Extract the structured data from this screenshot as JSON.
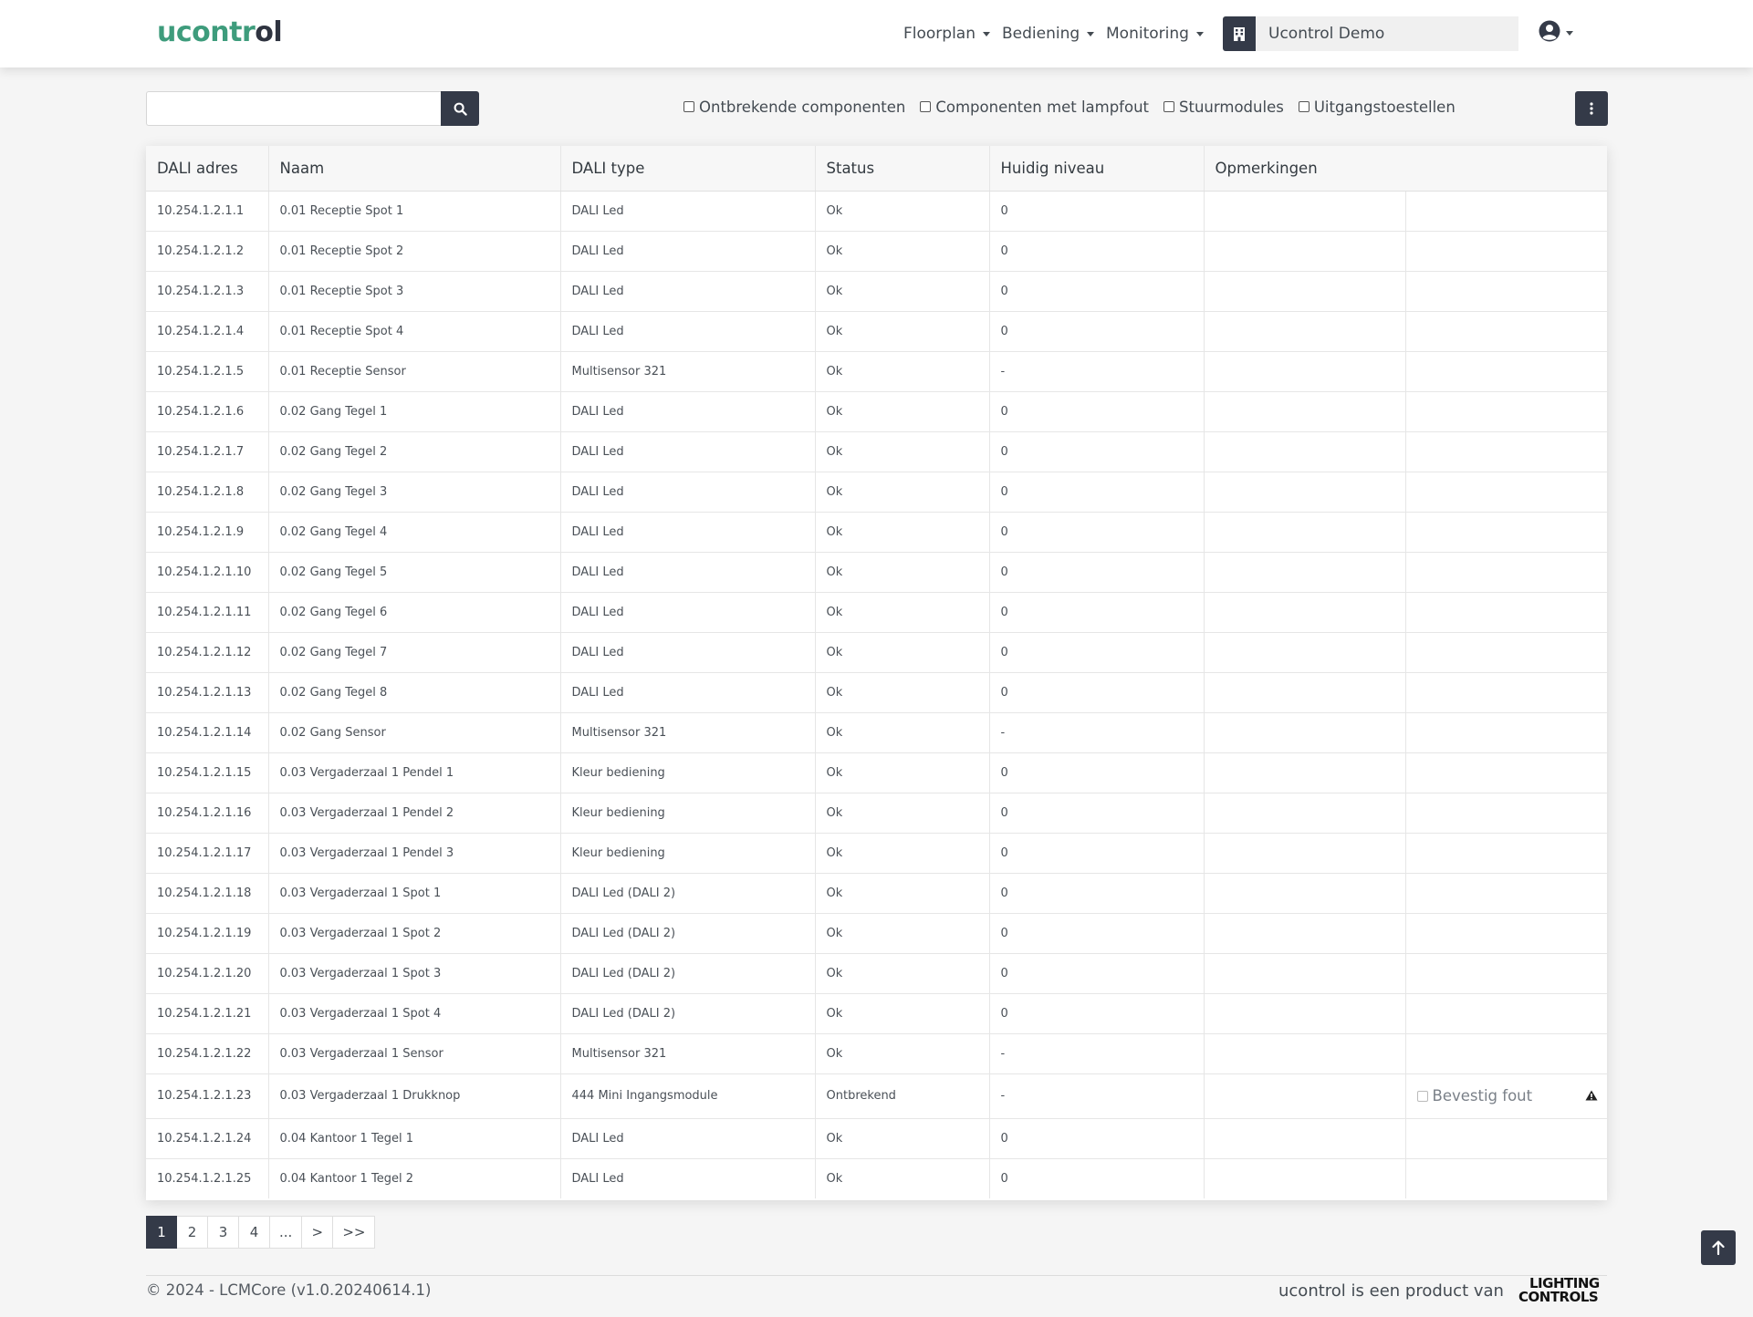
{
  "navbar": {
    "logo_part1": "ucontr",
    "logo_part2": "l",
    "menu": [
      {
        "label": "Floorplan"
      },
      {
        "label": "Bediening"
      },
      {
        "label": "Monitoring"
      }
    ],
    "site_name": "Ucontrol Demo",
    "icons": {
      "site": "building-icon",
      "user": "user-circle-icon"
    }
  },
  "toolbar": {
    "search_value": "",
    "filters": [
      {
        "label": "Ontbrekende componenten",
        "checked": false
      },
      {
        "label": "Componenten met lampfout",
        "checked": false
      },
      {
        "label": "Stuurmodules",
        "checked": false
      },
      {
        "label": "Uitgangstoestellen",
        "checked": false
      }
    ]
  },
  "table": {
    "headers": [
      "DALI adres",
      "Naam",
      "DALI type",
      "Status",
      "Huidig niveau",
      "Opmerkingen"
    ],
    "rows": [
      {
        "adres": "10.254.1.2.1.1",
        "naam": "0.01 Receptie Spot 1",
        "type": "DALI Led",
        "status": "Ok",
        "niveau": "0"
      },
      {
        "adres": "10.254.1.2.1.2",
        "naam": "0.01 Receptie Spot 2",
        "type": "DALI Led",
        "status": "Ok",
        "niveau": "0"
      },
      {
        "adres": "10.254.1.2.1.3",
        "naam": "0.01 Receptie Spot 3",
        "type": "DALI Led",
        "status": "Ok",
        "niveau": "0"
      },
      {
        "adres": "10.254.1.2.1.4",
        "naam": "0.01 Receptie Spot 4",
        "type": "DALI Led",
        "status": "Ok",
        "niveau": "0"
      },
      {
        "adres": "10.254.1.2.1.5",
        "naam": "0.01 Receptie Sensor",
        "type": "Multisensor 321",
        "status": "Ok",
        "niveau": "-"
      },
      {
        "adres": "10.254.1.2.1.6",
        "naam": "0.02 Gang Tegel 1",
        "type": "DALI Led",
        "status": "Ok",
        "niveau": "0"
      },
      {
        "adres": "10.254.1.2.1.7",
        "naam": "0.02 Gang Tegel 2",
        "type": "DALI Led",
        "status": "Ok",
        "niveau": "0"
      },
      {
        "adres": "10.254.1.2.1.8",
        "naam": "0.02 Gang Tegel 3",
        "type": "DALI Led",
        "status": "Ok",
        "niveau": "0"
      },
      {
        "adres": "10.254.1.2.1.9",
        "naam": "0.02 Gang Tegel 4",
        "type": "DALI Led",
        "status": "Ok",
        "niveau": "0"
      },
      {
        "adres": "10.254.1.2.1.10",
        "naam": "0.02 Gang Tegel 5",
        "type": "DALI Led",
        "status": "Ok",
        "niveau": "0"
      },
      {
        "adres": "10.254.1.2.1.11",
        "naam": "0.02 Gang Tegel 6",
        "type": "DALI Led",
        "status": "Ok",
        "niveau": "0"
      },
      {
        "adres": "10.254.1.2.1.12",
        "naam": "0.02 Gang Tegel 7",
        "type": "DALI Led",
        "status": "Ok",
        "niveau": "0"
      },
      {
        "adres": "10.254.1.2.1.13",
        "naam": "0.02 Gang Tegel 8",
        "type": "DALI Led",
        "status": "Ok",
        "niveau": "0"
      },
      {
        "adres": "10.254.1.2.1.14",
        "naam": "0.02 Gang Sensor",
        "type": "Multisensor 321",
        "status": "Ok",
        "niveau": "-"
      },
      {
        "adres": "10.254.1.2.1.15",
        "naam": "0.03 Vergaderzaal 1 Pendel 1",
        "type": "Kleur bediening",
        "status": "Ok",
        "niveau": "0"
      },
      {
        "adres": "10.254.1.2.1.16",
        "naam": "0.03 Vergaderzaal 1 Pendel 2",
        "type": "Kleur bediening",
        "status": "Ok",
        "niveau": "0"
      },
      {
        "adres": "10.254.1.2.1.17",
        "naam": "0.03 Vergaderzaal 1 Pendel 3",
        "type": "Kleur bediening",
        "status": "Ok",
        "niveau": "0"
      },
      {
        "adres": "10.254.1.2.1.18",
        "naam": "0.03 Vergaderzaal 1 Spot 1",
        "type": "DALI Led (DALI 2)",
        "status": "Ok",
        "niveau": "0"
      },
      {
        "adres": "10.254.1.2.1.19",
        "naam": "0.03 Vergaderzaal 1 Spot 2",
        "type": "DALI Led (DALI 2)",
        "status": "Ok",
        "niveau": "0"
      },
      {
        "adres": "10.254.1.2.1.20",
        "naam": "0.03 Vergaderzaal 1 Spot 3",
        "type": "DALI Led (DALI 2)",
        "status": "Ok",
        "niveau": "0"
      },
      {
        "adres": "10.254.1.2.1.21",
        "naam": "0.03 Vergaderzaal 1 Spot 4",
        "type": "DALI Led (DALI 2)",
        "status": "Ok",
        "niveau": "0"
      },
      {
        "adres": "10.254.1.2.1.22",
        "naam": "0.03 Vergaderzaal 1 Sensor",
        "type": "Multisensor 321",
        "status": "Ok",
        "niveau": "-"
      },
      {
        "adres": "10.254.1.2.1.23",
        "naam": "0.03 Vergaderzaal 1 Drukknop",
        "type": "444 Mini Ingangsmodule",
        "status": "Ontbrekend",
        "niveau": "-",
        "confirm": "Bevestig fout",
        "warning": true
      },
      {
        "adres": "10.254.1.2.1.24",
        "naam": "0.04 Kantoor 1 Tegel 1",
        "type": "DALI Led",
        "status": "Ok",
        "niveau": "0"
      },
      {
        "adres": "10.254.1.2.1.25",
        "naam": "0.04 Kantoor 1 Tegel 2",
        "type": "DALI Led",
        "status": "Ok",
        "niveau": "0"
      }
    ]
  },
  "pagination": {
    "pages": [
      "1",
      "2",
      "3",
      "4",
      "...",
      ">",
      ">>"
    ],
    "active": "1"
  },
  "footer": {
    "copyright": "© 2024 - LCMCore (v1.0.20240614.1)",
    "product_by": "ucontrol is een product van",
    "partner_line1": "LIGHTING",
    "partner_line2": "CONTROLS"
  },
  "colors": {
    "accent": "#3e9c7c",
    "dark": "#343a48",
    "background": "#f5f5f5"
  }
}
